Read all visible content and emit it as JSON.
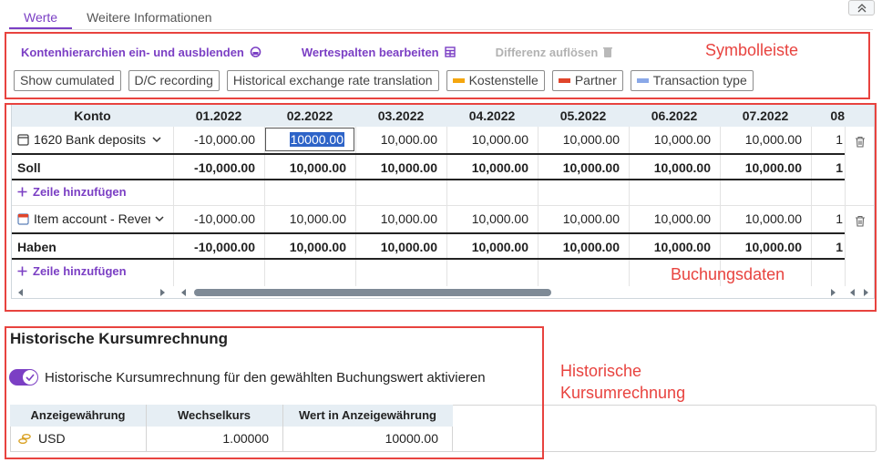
{
  "tabs": [
    {
      "label": "Werte",
      "active": true
    },
    {
      "label": "Weitere Informationen",
      "active": false
    }
  ],
  "toolbar": {
    "buttons": [
      {
        "label": "Kontenhierarchien ein- und ausblenden",
        "icon": "hierarchy-icon",
        "enabled": true
      },
      {
        "label": "Wertespalten bearbeiten",
        "icon": "columns-grid-icon",
        "enabled": true
      },
      {
        "label": "Differenz auflösen",
        "icon": "trash-icon",
        "enabled": false
      }
    ],
    "chips": [
      {
        "label": "Show cumulated",
        "swatch": null
      },
      {
        "label": "D/C recording",
        "swatch": null
      },
      {
        "label": "Historical exchange rate translation",
        "swatch": null
      },
      {
        "label": "Kostenstelle",
        "swatch": "#f4a60f"
      },
      {
        "label": "Partner",
        "swatch": "#e0452b"
      },
      {
        "label": "Transaction type",
        "swatch": "#8aa8e8"
      }
    ]
  },
  "annotations": {
    "toolbar": "Symbolleiste",
    "booking": "Buchungsdaten",
    "historic_line1": "Historische",
    "historic_line2": "Kursumrechnung"
  },
  "grid": {
    "account_header": "Konto",
    "periods": [
      "01.2022",
      "02.2022",
      "03.2022",
      "04.2022",
      "05.2022",
      "06.2022",
      "07.2022",
      "08"
    ],
    "debit_line": {
      "account": "1620 Bank deposits",
      "values": [
        "-10,000.00",
        "10000.00",
        "10,000.00",
        "10,000.00",
        "10,000.00",
        "10,000.00",
        "10,000.00",
        "1"
      ]
    },
    "debit_total": {
      "label": "Soll",
      "values": [
        "-10,000.00",
        "10,000.00",
        "10,000.00",
        "10,000.00",
        "10,000.00",
        "10,000.00",
        "10,000.00",
        "1"
      ]
    },
    "add_row_label": "Zeile hinzufügen",
    "credit_line": {
      "account": "Item account - Rever",
      "values": [
        "-10,000.00",
        "10,000.00",
        "10,000.00",
        "10,000.00",
        "10,000.00",
        "10,000.00",
        "10,000.00",
        "1"
      ]
    },
    "credit_total": {
      "label": "Haben",
      "values": [
        "-10,000.00",
        "10,000.00",
        "10,000.00",
        "10,000.00",
        "10,000.00",
        "10,000.00",
        "10,000.00",
        "1"
      ]
    }
  },
  "historic": {
    "title": "Historische Kursumrechnung",
    "toggle_label": "Historische Kursumrechnung für den gewählten Buchungswert aktivieren",
    "toggle_on": true,
    "columns": [
      "Anzeigewährung",
      "Wechselkurs",
      "Wert in Anzeigewährung"
    ],
    "row": {
      "currency": "USD",
      "rate": "1.00000",
      "value": "10000.00"
    }
  },
  "colors": {
    "accent": "#7b3fc4",
    "annotation": "#e8433f",
    "header_bg": "#e6eef4"
  }
}
